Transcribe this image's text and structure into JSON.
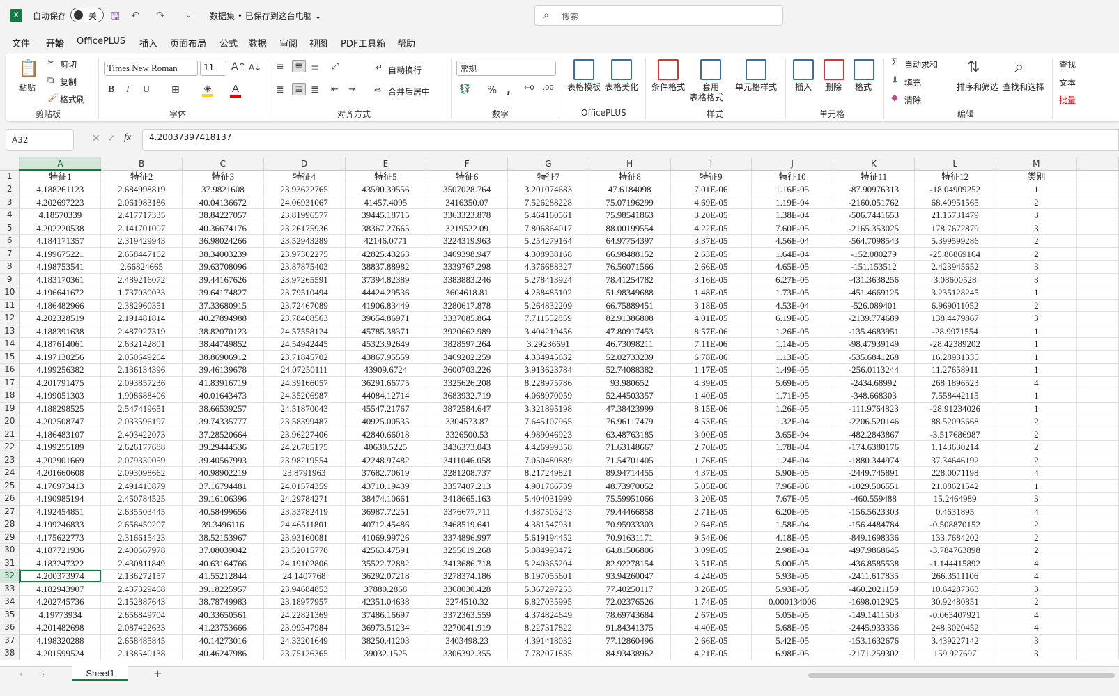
{
  "title": {
    "logo": "X",
    "autosave_label": "自动保存",
    "autosave_state": "关",
    "document": "数据集 • 已保存到这台电脑 ⌄"
  },
  "search": {
    "placeholder": "搜索"
  },
  "menu": [
    "文件",
    "开始",
    "OfficePLUS",
    "插入",
    "页面布局",
    "公式",
    "数据",
    "审阅",
    "视图",
    "PDF工具箱",
    "帮助"
  ],
  "ribbon": {
    "clipboard": {
      "paste": "粘贴",
      "cut": "剪切",
      "copy": "复制",
      "format_painter": "格式刷",
      "label": "剪贴板"
    },
    "font": {
      "name": "Times New Roman",
      "size": "11",
      "label": "字体"
    },
    "alignment": {
      "wrap": "自动换行",
      "merge": "合并后居中",
      "label": "对齐方式"
    },
    "number": {
      "format": "常规",
      "label": "数字"
    },
    "officeplus": {
      "template": "表格模板",
      "beautify": "表格美化",
      "label": "OfficePLUS"
    },
    "styles": {
      "conditional": "条件格式",
      "table_format_1": "套用",
      "table_format_2": "表格格式",
      "cell_styles": "单元格样式",
      "label": "样式"
    },
    "cells": {
      "insert": "插入",
      "delete": "删除",
      "format": "格式",
      "label": "单元格"
    },
    "editing": {
      "autosum": "自动求和",
      "fill": "填充",
      "clear": "清除",
      "sort": "排序和筛选",
      "find": "查找和选择",
      "label": "编辑"
    },
    "extra": {
      "find_replace": "查找",
      "text": "文本",
      "batch": "批量"
    }
  },
  "formula_bar": {
    "name_box": "A32",
    "value": "4.20037397418137",
    "fx": "fx"
  },
  "columns": [
    "A",
    "B",
    "C",
    "D",
    "E",
    "F",
    "G",
    "H",
    "I",
    "J",
    "K",
    "L",
    "M"
  ],
  "header_row": [
    "特征1",
    "特征2",
    "特征3",
    "特征4",
    "特征5",
    "特征6",
    "特征7",
    "特征8",
    "特征9",
    "特征10",
    "特征11",
    "特征12",
    "类别"
  ],
  "rows": [
    [
      "4.188261123",
      "2.684998819",
      "37.9821608",
      "23.93622765",
      "43590.39556",
      "3507028.764",
      "3.201074683",
      "47.6184098",
      "7.01E-06",
      "1.16E-05",
      "-87.90976313",
      "-18.04909252",
      "1"
    ],
    [
      "4.202697223",
      "2.061983186",
      "40.04136672",
      "24.06931067",
      "41457.4095",
      "3416350.07",
      "7.526288228",
      "75.07196299",
      "4.69E-05",
      "1.19E-04",
      "-2160.051762",
      "68.40951565",
      "2"
    ],
    [
      "4.18570339",
      "2.417717335",
      "38.84227057",
      "23.81996577",
      "39445.18715",
      "3363323.878",
      "5.464160561",
      "75.98541863",
      "3.20E-05",
      "1.38E-04",
      "-506.7441653",
      "21.15731479",
      "3"
    ],
    [
      "4.202220538",
      "2.141701007",
      "40.36674176",
      "23.26175936",
      "38367.27665",
      "3219522.09",
      "7.806864017",
      "88.00199554",
      "4.22E-05",
      "7.60E-05",
      "-2165.353025",
      "178.7672879",
      "3"
    ],
    [
      "4.184171357",
      "2.319429943",
      "36.98024266",
      "23.52943289",
      "42146.0771",
      "3224319.963",
      "5.254279164",
      "64.97754397",
      "3.37E-05",
      "4.56E-04",
      "-564.7098543",
      "5.399599286",
      "2"
    ],
    [
      "4.199675221",
      "2.658447162",
      "38.34003239",
      "23.97302275",
      "42825.43263",
      "3469398.947",
      "4.308938168",
      "66.98488152",
      "2.63E-05",
      "1.64E-04",
      "-152.080279",
      "-25.86869164",
      "2"
    ],
    [
      "4.198753541",
      "2.66824665",
      "39.63708096",
      "23.87875403",
      "38837.88982",
      "3339767.298",
      "4.376688327",
      "76.56071566",
      "2.66E-05",
      "4.65E-05",
      "-151.153512",
      "2.423945652",
      "3"
    ],
    [
      "4.183170361",
      "2.489216072",
      "39.44167626",
      "23.97265591",
      "37394.82389",
      "3383883.246",
      "5.278413924",
      "78.41254782",
      "3.16E-05",
      "6.27E-05",
      "-431.3638256",
      "3.08600528",
      "3"
    ],
    [
      "4.196641672",
      "1.737030033",
      "39.64174827",
      "23.79510494",
      "44424.29536",
      "3604618.81",
      "4.238485102",
      "51.98349688",
      "1.48E-05",
      "1.73E-05",
      "-451.4669125",
      "3.235128245",
      "1"
    ],
    [
      "4.186482966",
      "2.382960351",
      "37.33680915",
      "23.72467089",
      "41906.83449",
      "3280617.878",
      "5.264832209",
      "66.75889451",
      "3.18E-05",
      "4.53E-04",
      "-526.089401",
      "6.969011052",
      "2"
    ],
    [
      "4.202328519",
      "2.191481814",
      "40.27894988",
      "23.78408563",
      "39654.86971",
      "3337085.864",
      "7.711552859",
      "82.91386808",
      "4.01E-05",
      "6.19E-05",
      "-2139.774689",
      "138.4479867",
      "3"
    ],
    [
      "4.188391638",
      "2.487927319",
      "38.82070123",
      "24.57558124",
      "45785.38371",
      "3920662.989",
      "3.404219456",
      "47.80917453",
      "8.57E-06",
      "1.26E-05",
      "-135.4683951",
      "-28.9971554",
      "1"
    ],
    [
      "4.187614061",
      "2.632142801",
      "38.44749852",
      "24.54942445",
      "45323.92649",
      "3828597.264",
      "3.29236691",
      "46.73098211",
      "7.11E-06",
      "1.14E-05",
      "-98.47939149",
      "-28.42389202",
      "1"
    ],
    [
      "4.197130256",
      "2.050649264",
      "38.86906912",
      "23.71845702",
      "43867.95559",
      "3469202.259",
      "4.334945632",
      "52.02733239",
      "6.78E-06",
      "1.13E-05",
      "-535.6841268",
      "16.28931335",
      "1"
    ],
    [
      "4.199256382",
      "2.136134396",
      "39.46139678",
      "24.07250111",
      "43909.6724",
      "3600703.226",
      "3.913623784",
      "52.74088382",
      "1.17E-05",
      "1.49E-05",
      "-256.0113244",
      "11.27658911",
      "1"
    ],
    [
      "4.201791475",
      "2.093857236",
      "41.83916719",
      "24.39166057",
      "36291.66775",
      "3325626.208",
      "8.228975786",
      "93.980652",
      "4.39E-05",
      "5.69E-05",
      "-2434.68992",
      "268.1896523",
      "4"
    ],
    [
      "4.199051303",
      "1.908688406",
      "40.01643473",
      "24.35206987",
      "44084.12714",
      "3683932.719",
      "4.068970059",
      "52.44503357",
      "1.40E-05",
      "1.71E-05",
      "-348.668303",
      "7.558442115",
      "1"
    ],
    [
      "4.188298525",
      "2.547419651",
      "38.66539257",
      "24.51870043",
      "45547.21767",
      "3872584.647",
      "3.321895198",
      "47.38423999",
      "8.15E-06",
      "1.26E-05",
      "-111.9764823",
      "-28.91234026",
      "1"
    ],
    [
      "4.202508747",
      "2.033596197",
      "39.74335777",
      "23.58399487",
      "40925.00535",
      "3304573.87",
      "7.645107965",
      "76.96117479",
      "4.53E-05",
      "1.32E-04",
      "-2206.520146",
      "88.52095668",
      "2"
    ],
    [
      "4.186483107",
      "2.403422073",
      "37.28520664",
      "23.96227406",
      "42840.66018",
      "3326500.53",
      "4.989046923",
      "63.48763185",
      "3.00E-05",
      "3.65E-04",
      "-482.2843867",
      "-3.517686987",
      "2"
    ],
    [
      "4.199255189",
      "2.626177688",
      "39.29444536",
      "24.26785175",
      "40630.5225",
      "3436373.043",
      "4.426999358",
      "71.63148667",
      "2.70E-05",
      "1.78E-04",
      "-174.6380176",
      "1.143630214",
      "2"
    ],
    [
      "4.202901669",
      "2.079330059",
      "39.40567993",
      "23.98219554",
      "42248.97482",
      "3411046.058",
      "7.050480889",
      "71.54701405",
      "1.76E-05",
      "1.24E-04",
      "-1880.344974",
      "37.34646192",
      "2"
    ],
    [
      "4.201660608",
      "2.093098662",
      "40.98902219",
      "23.8791963",
      "37682.70619",
      "3281208.737",
      "8.217249821",
      "89.94714455",
      "4.37E-05",
      "5.90E-05",
      "-2449.745891",
      "228.0071198",
      "4"
    ],
    [
      "4.176973413",
      "2.491410879",
      "37.16794481",
      "24.01574359",
      "43710.19439",
      "3357407.213",
      "4.901766739",
      "48.73970052",
      "5.05E-06",
      "7.96E-06",
      "-1029.506551",
      "21.08621542",
      "1"
    ],
    [
      "4.190985194",
      "2.450784525",
      "39.16106396",
      "24.29784271",
      "38474.10661",
      "3418665.163",
      "5.404031999",
      "75.59951066",
      "3.20E-05",
      "7.67E-05",
      "-460.559488",
      "15.2464989",
      "3"
    ],
    [
      "4.192454851",
      "2.635503445",
      "40.58499656",
      "23.33782419",
      "36987.72251",
      "3376677.711",
      "4.387505243",
      "79.44466858",
      "2.71E-05",
      "6.20E-05",
      "-156.5623303",
      "0.4631895",
      "4"
    ],
    [
      "4.199246833",
      "2.656450207",
      "39.3496116",
      "24.46511801",
      "40712.45486",
      "3468519.641",
      "4.381547931",
      "70.95933303",
      "2.64E-05",
      "1.58E-04",
      "-156.4484784",
      "-0.508870152",
      "2"
    ],
    [
      "4.175622773",
      "2.316615423",
      "38.52153967",
      "23.93160081",
      "41069.99726",
      "3374896.997",
      "5.619194452",
      "70.91631171",
      "9.54E-06",
      "4.18E-05",
      "-849.1698336",
      "133.7684202",
      "2"
    ],
    [
      "4.187721936",
      "2.400667978",
      "37.08039042",
      "23.52015778",
      "42563.47591",
      "3255619.268",
      "5.084993472",
      "64.81506806",
      "3.09E-05",
      "2.98E-04",
      "-497.9868645",
      "-3.784763898",
      "2"
    ],
    [
      "4.183247322",
      "2.430811849",
      "40.63164766",
      "24.19102806",
      "35522.72882",
      "3413686.718",
      "5.240365204",
      "82.92278154",
      "3.51E-05",
      "5.00E-05",
      "-436.8585538",
      "-1.144415892",
      "4"
    ],
    [
      "4.200373974",
      "2.136272157",
      "41.55212844",
      "24.1407768",
      "36292.07218",
      "3278374.186",
      "8.197055601",
      "93.94260047",
      "4.24E-05",
      "5.93E-05",
      "-2411.617835",
      "266.3511106",
      "4"
    ],
    [
      "4.182943907",
      "2.437329468",
      "39.18225957",
      "23.94684853",
      "37880.2868",
      "3368030.428",
      "5.367297253",
      "77.40250117",
      "3.26E-05",
      "5.93E-05",
      "-460.2021159",
      "10.64287363",
      "3"
    ],
    [
      "4.202745736",
      "2.152887643",
      "38.78749983",
      "23.18977957",
      "42351.04638",
      "3274510.32",
      "6.827035995",
      "72.02376526",
      "1.74E-05",
      "0.000134006",
      "-1698.012925",
      "30.92480851",
      "2"
    ],
    [
      "4.19773934",
      "2.656849704",
      "40.33650561",
      "24.22821369",
      "37486.16697",
      "3372363.559",
      "4.374824649",
      "78.69743684",
      "2.67E-05",
      "5.05E-05",
      "-149.1411503",
      "-0.063407921",
      "4"
    ],
    [
      "4.201482698",
      "2.087422633",
      "41.23753666",
      "23.99347984",
      "36973.51234",
      "3270041.919",
      "8.227317822",
      "91.84341375",
      "4.40E-05",
      "5.68E-05",
      "-2445.933336",
      "248.3020452",
      "4"
    ],
    [
      "4.198320288",
      "2.658485845",
      "40.14273016",
      "24.33201649",
      "38250.41203",
      "3403498.23",
      "4.391418032",
      "77.12860496",
      "2.66E-05",
      "5.42E-05",
      "-153.1632676",
      "3.439227142",
      "3"
    ],
    [
      "4.201599524",
      "2.138540138",
      "40.46247986",
      "23.75126365",
      "39032.1525",
      "3306392.355",
      "7.782071835",
      "84.93438962",
      "4.21E-05",
      "6.98E-05",
      "-2171.259302",
      "159.927697",
      "3"
    ]
  ],
  "sheet_tab": "Sheet1",
  "colors": {
    "accent": "#107c41",
    "selected_header": "#d2e6d9",
    "grid": "#e1e1e1"
  }
}
